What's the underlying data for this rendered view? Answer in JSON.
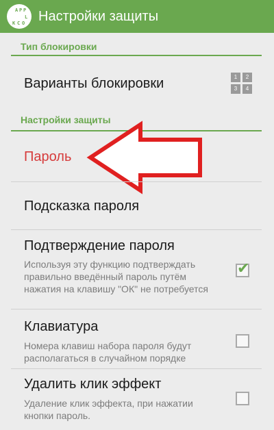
{
  "appbar": {
    "title": "Настройки защиты",
    "logo_letters": [
      "A",
      "P",
      "P",
      "L",
      "O",
      "C",
      "K"
    ]
  },
  "sections": {
    "lock_type": "Тип блокировки",
    "protection": "Настройки защиты"
  },
  "items": {
    "lock_variants": {
      "title": "Варианты блокировки",
      "grid": [
        "1",
        "2",
        "3",
        "4"
      ]
    },
    "password": {
      "title": "Пароль"
    },
    "hint": {
      "title": "Подсказка пароля"
    },
    "confirm": {
      "title": "Подтверждение пароля",
      "summary": "Используя эту функцию подтверждать правильно введённый пароль путём нажатия на клавишу \"ОК\" не потребуется",
      "checked": true
    },
    "keyboard": {
      "title": "Клавиатура",
      "summary": "Номера клавиш набора пароля будут располагаться в случайном порядке",
      "checked": false
    },
    "click_effect": {
      "title": "Удалить клик эффект",
      "summary": "Удаление клик эффекта, при нажатии кнопки пароль.",
      "checked": false
    }
  },
  "colors": {
    "accent": "#6aa84f",
    "password_text": "#d63b3b",
    "arrow": "#e02020"
  }
}
